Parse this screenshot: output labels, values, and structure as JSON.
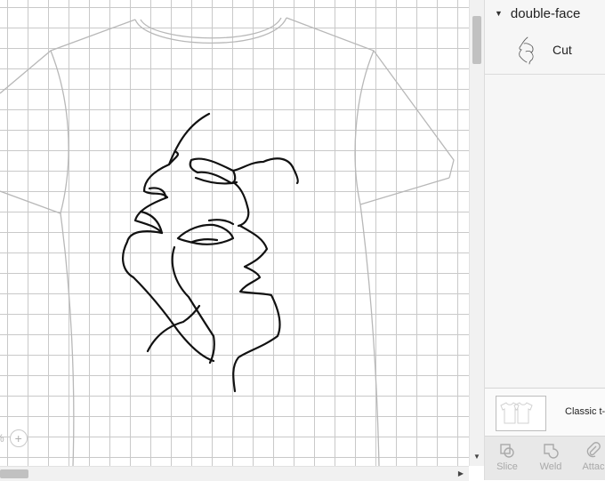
{
  "layers": {
    "group_name": "double-face",
    "item_operation": "Cut"
  },
  "canvas_panel": {
    "label": "Classic t-"
  },
  "tools": [
    {
      "label": "Slice",
      "icon": "slice-icon"
    },
    {
      "label": "Weld",
      "icon": "weld-icon"
    },
    {
      "label": "Attac",
      "icon": "attach-icon"
    }
  ],
  "zoom": {
    "value_text": "%",
    "plus_label": "+"
  },
  "colors": {
    "grid": "#c9c9c9",
    "shirt_outline": "#b8b8b8",
    "artwork": "#111111",
    "panel_bg": "#f6f6f6"
  }
}
